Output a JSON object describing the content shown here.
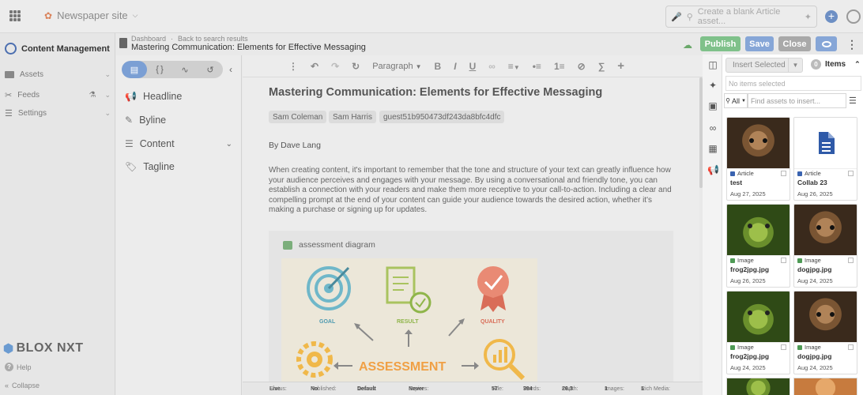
{
  "topbar": {
    "site_name": "Newspaper site",
    "search_placeholder": "Create a blank Article asset..."
  },
  "nav": {
    "title": "Content Management",
    "items": [
      {
        "label": "Assets"
      },
      {
        "label": "Feeds"
      },
      {
        "label": "Settings"
      }
    ],
    "logo_text": "BLOX NXT",
    "help": "Help",
    "collapse": "Collapse"
  },
  "header": {
    "breadcrumbs": [
      "Dashboard",
      "Back to search results"
    ],
    "breadcrumb_sep": "·",
    "title": "Mastering Communication: Elements for Effective Messaging",
    "publish": "Publish",
    "save": "Save",
    "close": "Close"
  },
  "fields": {
    "items": [
      {
        "label": "Headline"
      },
      {
        "label": "Byline"
      },
      {
        "label": "Content"
      },
      {
        "label": "Tagline"
      }
    ]
  },
  "toolbar": {
    "paragraph": "Paragraph"
  },
  "article": {
    "title": "Mastering Communication: Elements for Effective Messaging",
    "authors": [
      "Sam Coleman",
      "Sam Harris",
      "guest51b950473df243da8bfc4dfc"
    ],
    "byline": "By Dave Lang",
    "body": "When creating content, it's important to remember that the tone and structure of your text can greatly influence how your audience perceives and engages with your message. By using a conversational and friendly tone, you can establish a connection with your readers and make them more receptive to your call-to-action. Including a clear and compelling prompt at the end of your content can guide your audience towards the desired action, whether it's making a purchase or signing up for updates.",
    "image_caption": "assessment diagram",
    "diagram": {
      "goal": "GOAL",
      "result": "RESULT",
      "quality": "QUALITY",
      "assessment": "ASSESSMENT"
    }
  },
  "status": {
    "status_label": "Status:",
    "status": "Live",
    "published_label": "Published:",
    "published": "No",
    "access_label": "Access:",
    "access": "Default",
    "expires_label": "Expires:",
    "expires": "Never",
    "title_label": "Title:",
    "title": "57",
    "words_label": "Words:",
    "words": "394",
    "depth_label": "Depth:",
    "depth": "26.3",
    "images_label": "Images:",
    "images": "1",
    "rich_label": "Rich Media:",
    "rich": "1"
  },
  "assets": {
    "insert_selected": "Insert Selected",
    "items_count": "0",
    "items_label": "Items",
    "no_items": "No items selected",
    "filter": "All",
    "find_placeholder": "Find assets to insert...",
    "cards": [
      {
        "type": "Article",
        "name": "test",
        "date": "Aug 27, 2025",
        "thumb": "dog"
      },
      {
        "type": "Article",
        "name": "Collab 23",
        "date": "Aug 26, 2025",
        "thumb": "doc"
      },
      {
        "type": "Image",
        "name": "frog2jpg.jpg",
        "date": "Aug 26, 2025",
        "thumb": "frog"
      },
      {
        "type": "Image",
        "name": "dogjpg.jpg",
        "date": "Aug 24, 2025",
        "thumb": "dog"
      },
      {
        "type": "Image",
        "name": "frog2jpg.jpg",
        "date": "Aug 24, 2025",
        "thumb": "frog"
      },
      {
        "type": "Image",
        "name": "dogjpg.jpg",
        "date": "Aug 24, 2025",
        "thumb": "dog"
      }
    ]
  },
  "colors": {
    "accent": "#7b9fd4",
    "publish": "#7fc18a",
    "article_type": "#3a63b0",
    "image_type": "#4e9a55"
  }
}
